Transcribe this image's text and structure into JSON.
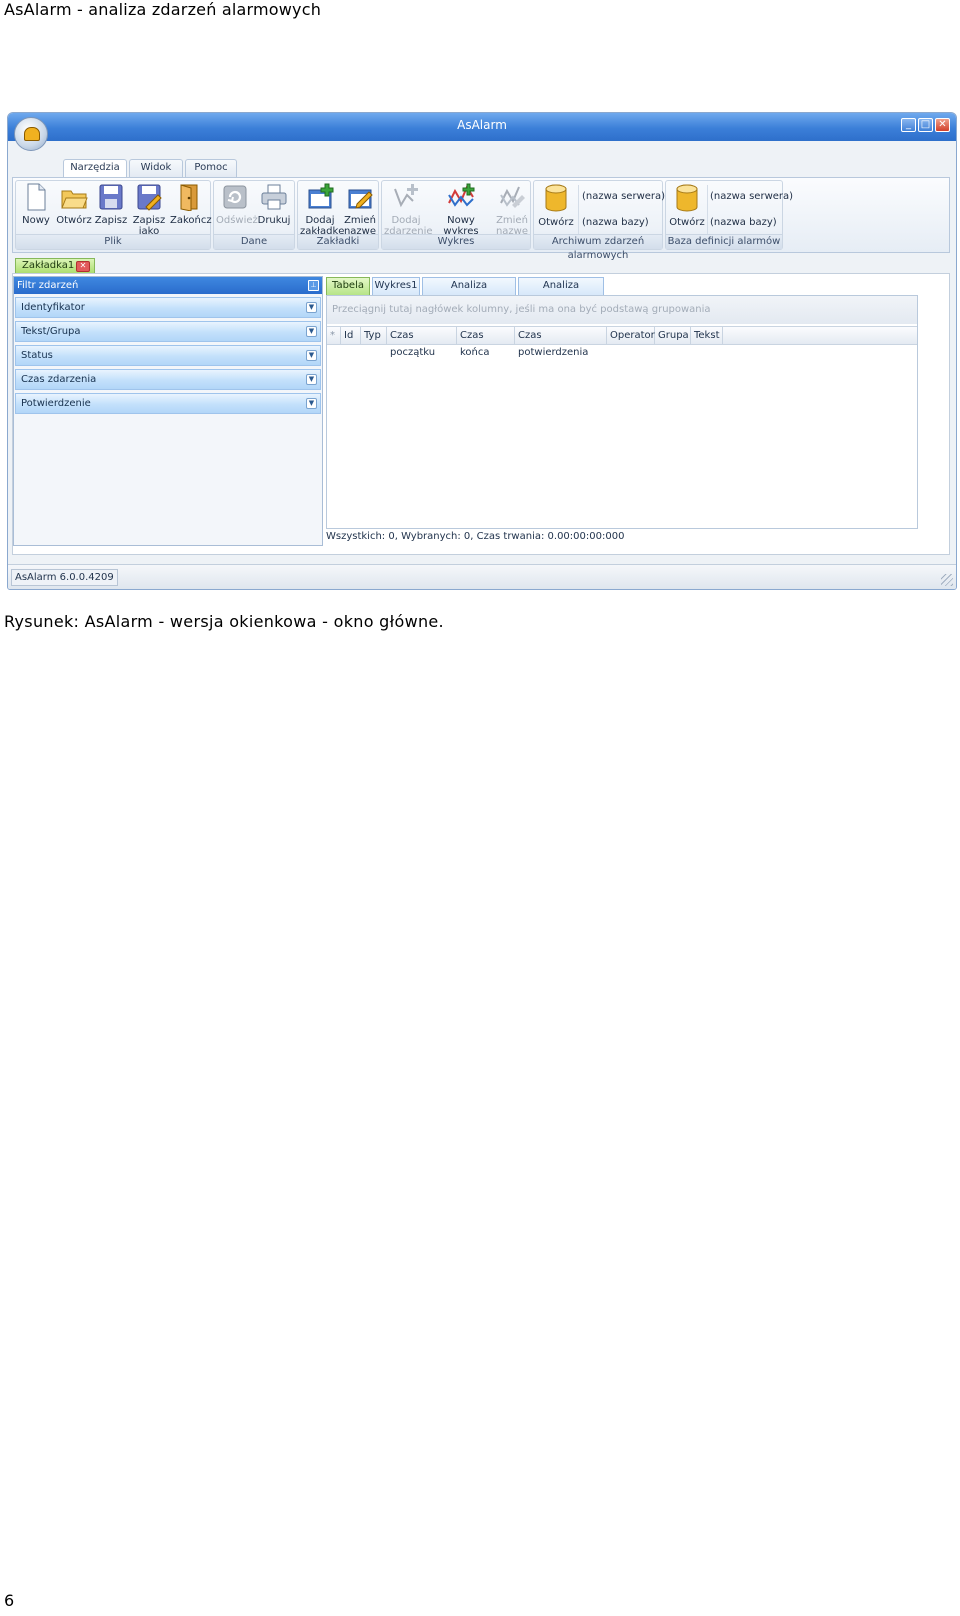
{
  "page": {
    "heading": "AsAlarm - analiza zdarzeń alarmowych",
    "caption": "Rysunek: AsAlarm - wersja okienkowa - okno główne.",
    "page_number": "6"
  },
  "window": {
    "title": "AsAlarm",
    "controls": {
      "minimize": "_",
      "maximize": "□",
      "close": "✕"
    }
  },
  "ribbon": {
    "tabs": [
      "Narzędzia",
      "Widok",
      "Pomoc"
    ],
    "active_tab": "Narzędzia",
    "groups": {
      "plik": {
        "label": "Plik",
        "nowy": "Nowy",
        "otworz": "Otwórz",
        "zapisz": "Zapisz",
        "zapisz_jako_1": "Zapisz",
        "zapisz_jako_2": "jako",
        "zakoncz": "Zakończ"
      },
      "dane": {
        "label": "Dane",
        "odswiez": "Odśwież",
        "drukuj": "Drukuj"
      },
      "zakladki": {
        "label": "Zakładki",
        "dodaj_1": "Dodaj",
        "dodaj_2": "zakładkę",
        "zmien_1": "Zmień",
        "zmien_2": "nazwę"
      },
      "wykres": {
        "label": "Wykres",
        "dodaj_zdarzenie_1": "Dodaj",
        "dodaj_zdarzenie_2": "zdarzenie",
        "nowy_wykres": "Nowy wykres",
        "zmien_1": "Zmień",
        "zmien_2": "nazwę"
      },
      "archiwum": {
        "label": "Archiwum zdarzeń alarmowych",
        "otworz": "Otwórz",
        "serwer": "(nazwa serwera)",
        "baza": "(nazwa bazy)"
      },
      "baza_definicji": {
        "label": "Baza definicji alarmów",
        "otworz": "Otwórz",
        "serwer": "(nazwa serwera)",
        "baza": "(nazwa bazy)"
      }
    }
  },
  "doc_tab": {
    "label": "Zakładka1",
    "close": "✕"
  },
  "filter": {
    "title": "Filtr zdarzeń",
    "pin": "⊥",
    "dropdown_glyph": "▼",
    "items": [
      "Identyfikator",
      "Tekst/Grupa",
      "Status",
      "Czas zdarzenia",
      "Potwierdzenie"
    ]
  },
  "view": {
    "tabs": [
      "Tabela",
      "Wykres1",
      "Analiza dynamiczna",
      "Analiza statyczna"
    ],
    "active_tab": "Tabela",
    "group_hint": "Przeciągnij tutaj nagłówek kolumny, jeśli ma ona być podstawą grupowania",
    "columns": [
      "*",
      "Id",
      "Typ",
      "Czas początku",
      "Czas końca",
      "Czas potwierdzenia",
      "Operator",
      "Grupa",
      "Tekst"
    ],
    "status": "Wszystkich: 0,  Wybranych: 0,   Czas trwania: 0.00:00:00:000"
  },
  "statusbar": {
    "version": "AsAlarm 6.0.0.4209"
  }
}
